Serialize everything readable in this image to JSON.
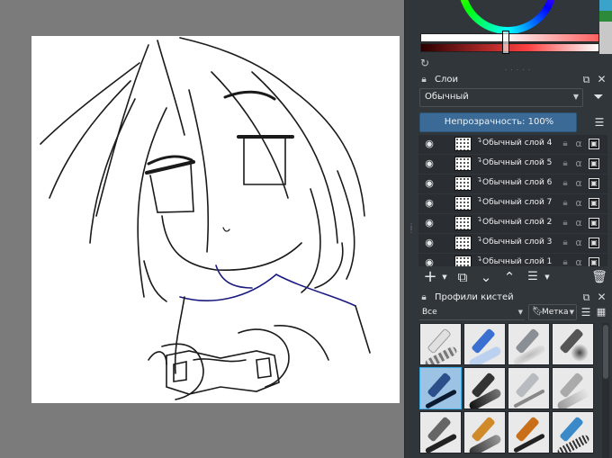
{
  "layers_panel": {
    "title": "Слои",
    "blend_mode": "Обычный",
    "opacity_label": "Непрозрачность:  100%",
    "layers": [
      {
        "name": "Обычный слой 4"
      },
      {
        "name": "Обычный слой 5"
      },
      {
        "name": "Обычный слой 6"
      },
      {
        "name": "Обычный слой 7"
      },
      {
        "name": "Обычный слой 2"
      },
      {
        "name": "Обычный слой 3"
      },
      {
        "name": "Обычный слой 1"
      }
    ]
  },
  "brush_panel": {
    "title": "Профили кистей",
    "tag_filter": "Все",
    "tag_button": "Метка"
  },
  "colors": {
    "accent": "#3daee9",
    "opacity_bar": "#3a6a95",
    "panel_bg": "#31363b",
    "canvas_bg": "#7b7b7b"
  },
  "icons": {
    "visibility": "eye-icon",
    "lock": "lock-icon",
    "alpha": "alpha-icon",
    "add_layer": "plus-icon",
    "duplicate": "duplicate-icon",
    "move_down": "chevron-down-icon",
    "move_up": "chevron-up-icon",
    "properties": "sliders-icon",
    "delete": "trash-icon"
  }
}
